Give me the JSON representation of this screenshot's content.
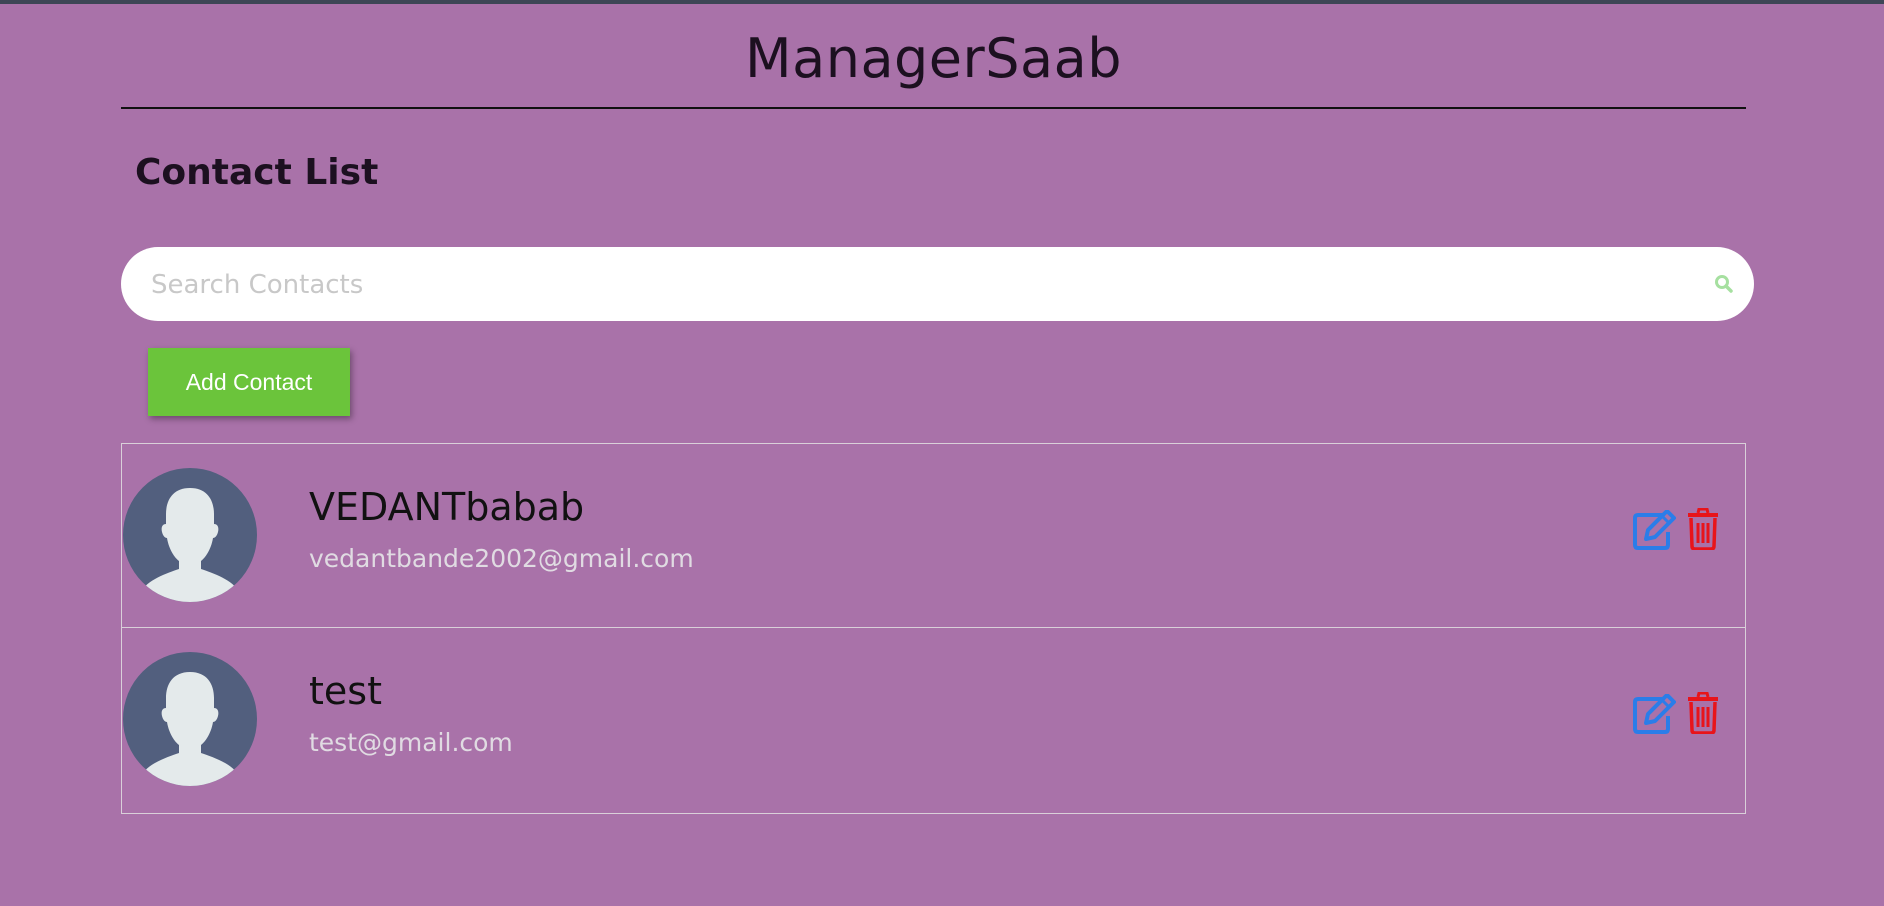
{
  "app": {
    "title": "ManagerSaab"
  },
  "contacts_section": {
    "heading": "Contact List"
  },
  "search": {
    "placeholder": "Search Contacts",
    "value": "",
    "icon": "search-icon"
  },
  "toolbar": {
    "add_label": "Add Contact"
  },
  "contacts": [
    {
      "name": "VEDANTbabab",
      "email": "vedantbande2002@gmail.com",
      "avatar_icon": "default-avatar-icon",
      "edit_icon": "edit-icon",
      "delete_icon": "trash-icon"
    },
    {
      "name": "test",
      "email": "test@gmail.com",
      "avatar_icon": "default-avatar-icon",
      "edit_icon": "edit-icon",
      "delete_icon": "trash-icon"
    }
  ],
  "colors": {
    "background": "#a972a9",
    "primary_button": "#6bc43b",
    "edit_icon": "#2b7de9",
    "delete_icon": "#e8141a",
    "avatar_bg": "#525f7e",
    "avatar_figure": "#e4eaeb",
    "email_text": "#e0dbe2",
    "search_icon": "#a6e0a0"
  }
}
